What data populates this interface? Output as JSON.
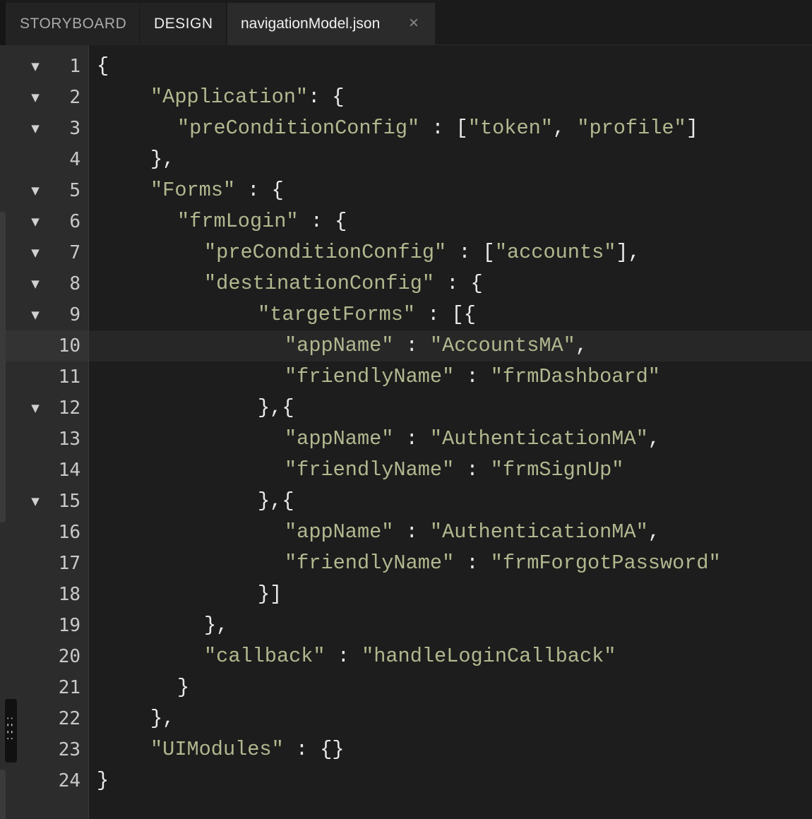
{
  "tabs": {
    "storyboard": "STORYBOARD",
    "design": "DESIGN",
    "file": "navigationModel.json",
    "close": "×"
  },
  "icons": {
    "fold": "chevron-down-icon",
    "close": "close-icon",
    "drag": "drag-handle-icon"
  },
  "colors": {
    "background": "#1d1d1d",
    "gutter": "#2c2c2c",
    "string": "#b1b88f",
    "punctuation": "#e9e9e9"
  },
  "editor": {
    "active_line": 10,
    "lines": [
      {
        "n": "1",
        "fold": true,
        "indent": 0,
        "code": "{"
      },
      {
        "n": "2",
        "fold": true,
        "indent": 4,
        "code": "\"Application\": {"
      },
      {
        "n": "3",
        "fold": true,
        "indent": 6,
        "code": "\"preConditionConfig\" : [\"token\", \"profile\"]"
      },
      {
        "n": "4",
        "fold": false,
        "indent": 4,
        "code": "},"
      },
      {
        "n": "5",
        "fold": true,
        "indent": 4,
        "code": "\"Forms\" : {"
      },
      {
        "n": "6",
        "fold": true,
        "indent": 6,
        "code": "\"frmLogin\" : {"
      },
      {
        "n": "7",
        "fold": true,
        "indent": 8,
        "code": "\"preConditionConfig\" : [\"accounts\"],"
      },
      {
        "n": "8",
        "fold": true,
        "indent": 8,
        "code": "\"destinationConfig\" : {"
      },
      {
        "n": "9",
        "fold": true,
        "indent": 12,
        "code": "\"targetForms\" : [{"
      },
      {
        "n": "10",
        "fold": false,
        "indent": 14,
        "code": "\"appName\" : \"AccountsMA\","
      },
      {
        "n": "11",
        "fold": false,
        "indent": 14,
        "code": "\"friendlyName\" : \"frmDashboard\""
      },
      {
        "n": "12",
        "fold": true,
        "indent": 12,
        "code": "},{"
      },
      {
        "n": "13",
        "fold": false,
        "indent": 14,
        "code": "\"appName\" : \"AuthenticationMA\","
      },
      {
        "n": "14",
        "fold": false,
        "indent": 14,
        "code": "\"friendlyName\" : \"frmSignUp\""
      },
      {
        "n": "15",
        "fold": true,
        "indent": 12,
        "code": "},{"
      },
      {
        "n": "16",
        "fold": false,
        "indent": 14,
        "code": "\"appName\" : \"AuthenticationMA\","
      },
      {
        "n": "17",
        "fold": false,
        "indent": 14,
        "code": "\"friendlyName\" : \"frmForgotPassword\""
      },
      {
        "n": "18",
        "fold": false,
        "indent": 12,
        "code": "}]"
      },
      {
        "n": "19",
        "fold": false,
        "indent": 8,
        "code": "},"
      },
      {
        "n": "20",
        "fold": false,
        "indent": 8,
        "code": "\"callback\" : \"handleLoginCallback\""
      },
      {
        "n": "21",
        "fold": false,
        "indent": 6,
        "code": "}"
      },
      {
        "n": "22",
        "fold": false,
        "indent": 4,
        "code": "},"
      },
      {
        "n": "23",
        "fold": false,
        "indent": 4,
        "code": "\"UIModules\" : {}"
      },
      {
        "n": "24",
        "fold": false,
        "indent": 0,
        "code": "}"
      }
    ]
  }
}
